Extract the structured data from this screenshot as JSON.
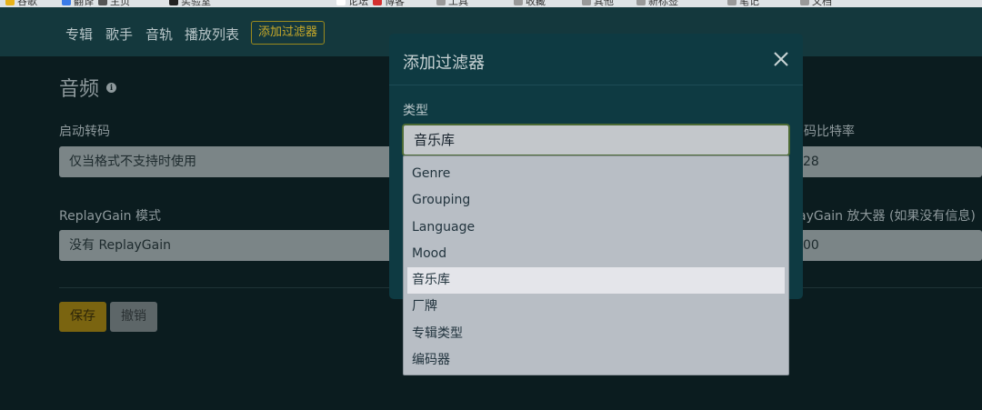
{
  "bookmarks": [
    {
      "label": "谷歌",
      "color": "#e8b21a"
    },
    {
      "label": "翻译",
      "color": "#3b7be8"
    },
    {
      "label": "主页",
      "color": "#555555"
    },
    {
      "label": "实验室",
      "color": "#222222"
    },
    {
      "label": "论坛",
      "color": "#ffffff"
    },
    {
      "label": "博客",
      "color": "#d32f2f"
    },
    {
      "label": "工具",
      "color": "#999999"
    },
    {
      "label": "收藏",
      "color": "#999999"
    },
    {
      "label": "其他",
      "color": "#999999"
    },
    {
      "label": "新标签",
      "color": "#999999"
    },
    {
      "label": "笔记",
      "color": "#999999"
    },
    {
      "label": "文档",
      "color": "#999999"
    }
  ],
  "nav": {
    "links": [
      "专辑",
      "歌手",
      "音轨",
      "播放列表"
    ],
    "filter_button": "添加过滤器"
  },
  "page": {
    "title": "音频",
    "info_icon": "i",
    "transcode_label": "启动转码",
    "transcode_value": "仅当格式不支持时使用",
    "bitrate_label": "码比特率",
    "bitrate_value": "28",
    "replaygain_mode_label": "ReplayGain 模式",
    "replaygain_mode_value": "没有 ReplayGain",
    "replaygain_amp_label": "ayGain 放大器 (如果没有信息)",
    "replaygain_amp_value": "00",
    "save_button": "保存",
    "cancel_button": "撤销"
  },
  "modal": {
    "title": "添加过滤器",
    "type_label": "类型",
    "select_value": "音乐库",
    "options": [
      "Genre",
      "Grouping",
      "Language",
      "Mood",
      "音乐库",
      "厂牌",
      "专辑类型",
      "编码器"
    ],
    "selected_index": 4
  },
  "colors": {
    "accent": "#c8aa2a",
    "modal_bg": "#0e3a42",
    "navbar_bg": "#14383d",
    "page_bg": "#0b1c1f"
  }
}
